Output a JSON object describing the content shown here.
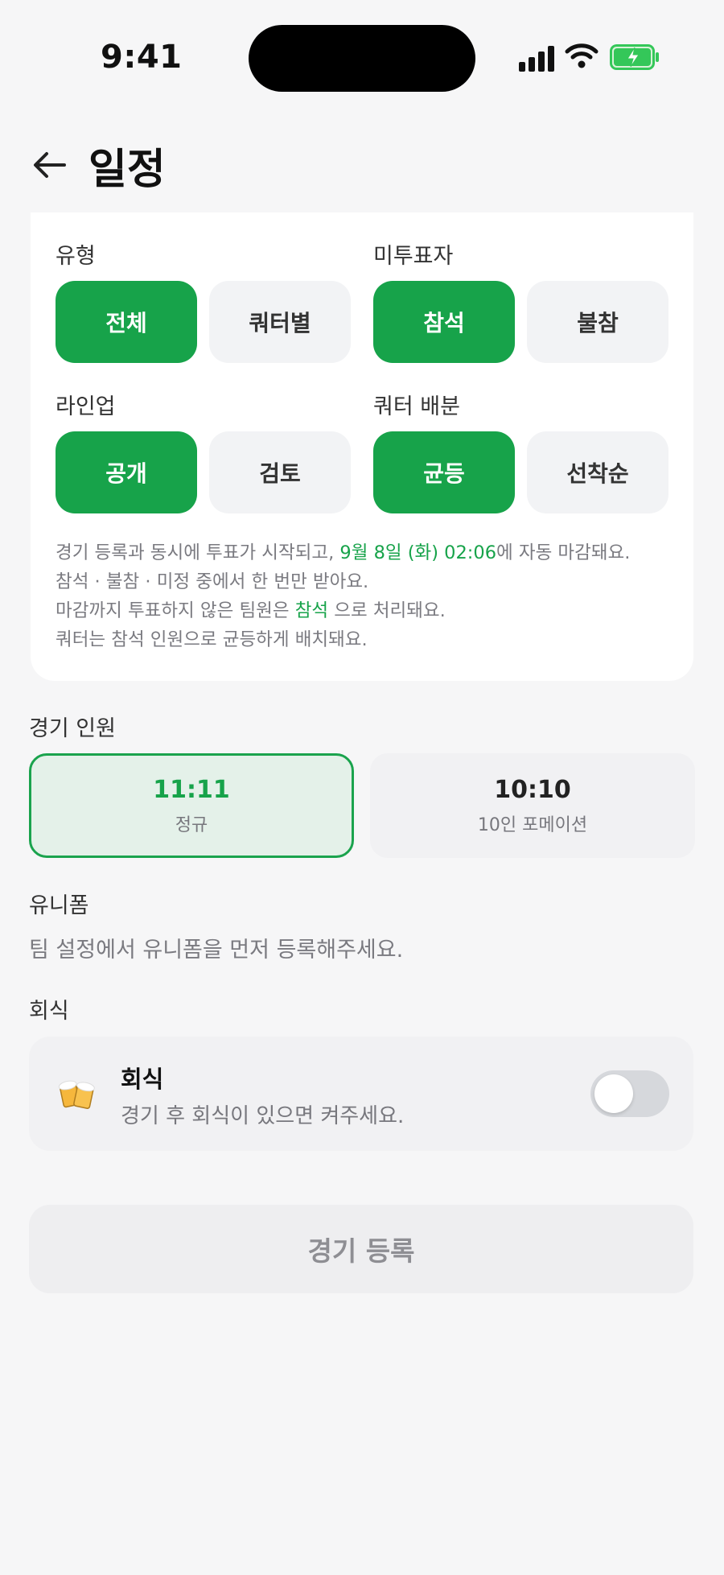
{
  "status": {
    "time": "9:41"
  },
  "header": {
    "title": "일정"
  },
  "settings": {
    "type": {
      "label": "유형",
      "options": [
        "전체",
        "쿼터별"
      ],
      "selected": "전체"
    },
    "non_voter": {
      "label": "미투표자",
      "options": [
        "참석",
        "불참"
      ],
      "selected": "참석"
    },
    "lineup": {
      "label": "라인업",
      "options": [
        "공개",
        "검토"
      ],
      "selected": "공개"
    },
    "quarter": {
      "label": "쿼터 배분",
      "options": [
        "균등",
        "선착순"
      ],
      "selected": "균등"
    },
    "notes": {
      "line1_pre": "경기 등록과 동시에 투표가 시작되고, ",
      "line1_highlight": "9월 8일 (화) 02:06",
      "line1_post": "에 자동 마감돼요.",
      "line2": "참석 · 불참 · 미정 중에서 한 번만 받아요.",
      "line3_pre": "마감까지 투표하지 않은 팀원은 ",
      "line3_highlight": "참석",
      "line3_post": "  으로 처리돼요.",
      "line4": "쿼터는 참석 인원으로 균등하게 배치돼요."
    }
  },
  "match_size": {
    "label": "경기 인원",
    "options": [
      {
        "main": "11:11",
        "sub": "정규",
        "selected": true
      },
      {
        "main": "10:10",
        "sub": "10인 포메이션",
        "selected": false
      }
    ]
  },
  "uniform": {
    "label": "유니폼",
    "message": "팀 설정에서 유니폼을 먼저 등록해주세요."
  },
  "dinner": {
    "label": "회식",
    "icon": "beer-mugs-icon",
    "title": "회식",
    "description": "경기 후 회식이 있으면 켜주세요.",
    "enabled": false
  },
  "register": {
    "label": "경기 등록"
  },
  "colors": {
    "accent": "#17a34a",
    "accent_light": "#e4f1e9",
    "chip_off": "#f2f3f5"
  }
}
